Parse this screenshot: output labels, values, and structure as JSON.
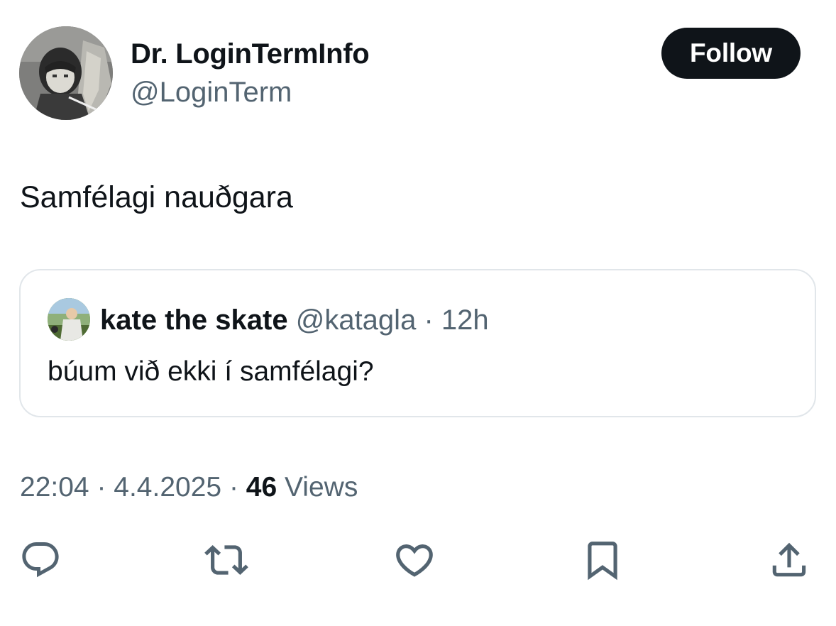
{
  "author": {
    "display_name": "Dr. LoginTermInfo",
    "handle": "@LoginTerm",
    "avatar_icon": "profile-avatar"
  },
  "follow_button": {
    "label": "Follow"
  },
  "tweet": {
    "text": "Samfélagi nauðgara",
    "time": "22:04",
    "separator": "·",
    "date": "4.4.2025",
    "views_count": "46",
    "views_label": "Views"
  },
  "quote": {
    "name": "kate the skate",
    "handle": "@katagla",
    "separator": "·",
    "age": "12h",
    "text": "búum við ekki í samfélagi?"
  },
  "actions": [
    {
      "icon": "reply-icon"
    },
    {
      "icon": "retweet-icon"
    },
    {
      "icon": "like-icon"
    },
    {
      "icon": "bookmark-icon"
    },
    {
      "icon": "share-icon"
    }
  ],
  "colors": {
    "text_primary": "#0f1419",
    "text_secondary": "#536471",
    "border": "#e1e6ea",
    "button_bg": "#0f1419"
  }
}
